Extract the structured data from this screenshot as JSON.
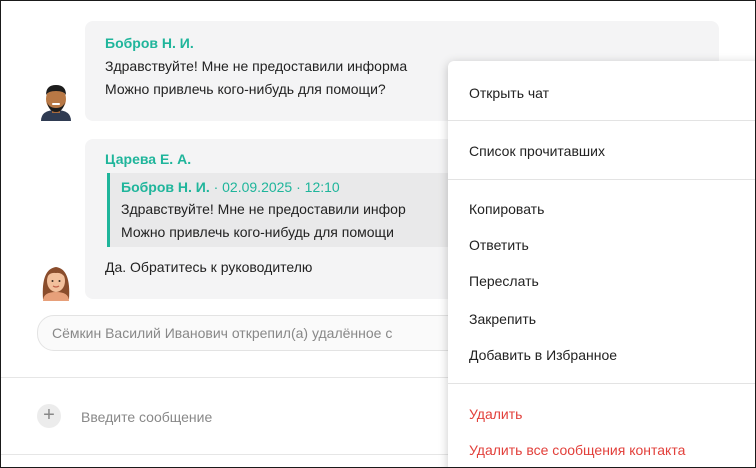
{
  "messages": [
    {
      "author": "Бобров Н. И.",
      "lines": [
        "Здравствуйте! Мне не предоставили информа",
        "Можно привлечь кого-нибудь для помощи?"
      ],
      "avatar": "man-avatar"
    },
    {
      "author": "Царева Е. А.",
      "quote": {
        "author": "Бобров Н. И.",
        "meta": " · 02.09.2025 · 12:10",
        "lines": [
          "Здравствуйте! Мне не предоставили инфор",
          "Можно привлечь кого-нибудь для помощи"
        ]
      },
      "text": "Да. Обратитесь к руководителю",
      "avatar": "woman-avatar"
    }
  ],
  "system_message": "Сёмкин Василий Иванович открепил(а) удалённое с",
  "composer": {
    "placeholder": "Введите сообщение",
    "add_icon": "plus-icon"
  },
  "context_menu": {
    "open_chat": "Открыть чат",
    "readers_list": "Список прочитавших",
    "copy": "Копировать",
    "reply": "Ответить",
    "forward": "Переслать",
    "pin": "Закрепить",
    "add_favorite": "Добавить в Избранное",
    "delete": "Удалить",
    "delete_all": "Удалить все сообщения контакта"
  },
  "colors": {
    "author": "#1fb59b",
    "danger": "#e2403b",
    "bubble": "#f4f4f5"
  }
}
